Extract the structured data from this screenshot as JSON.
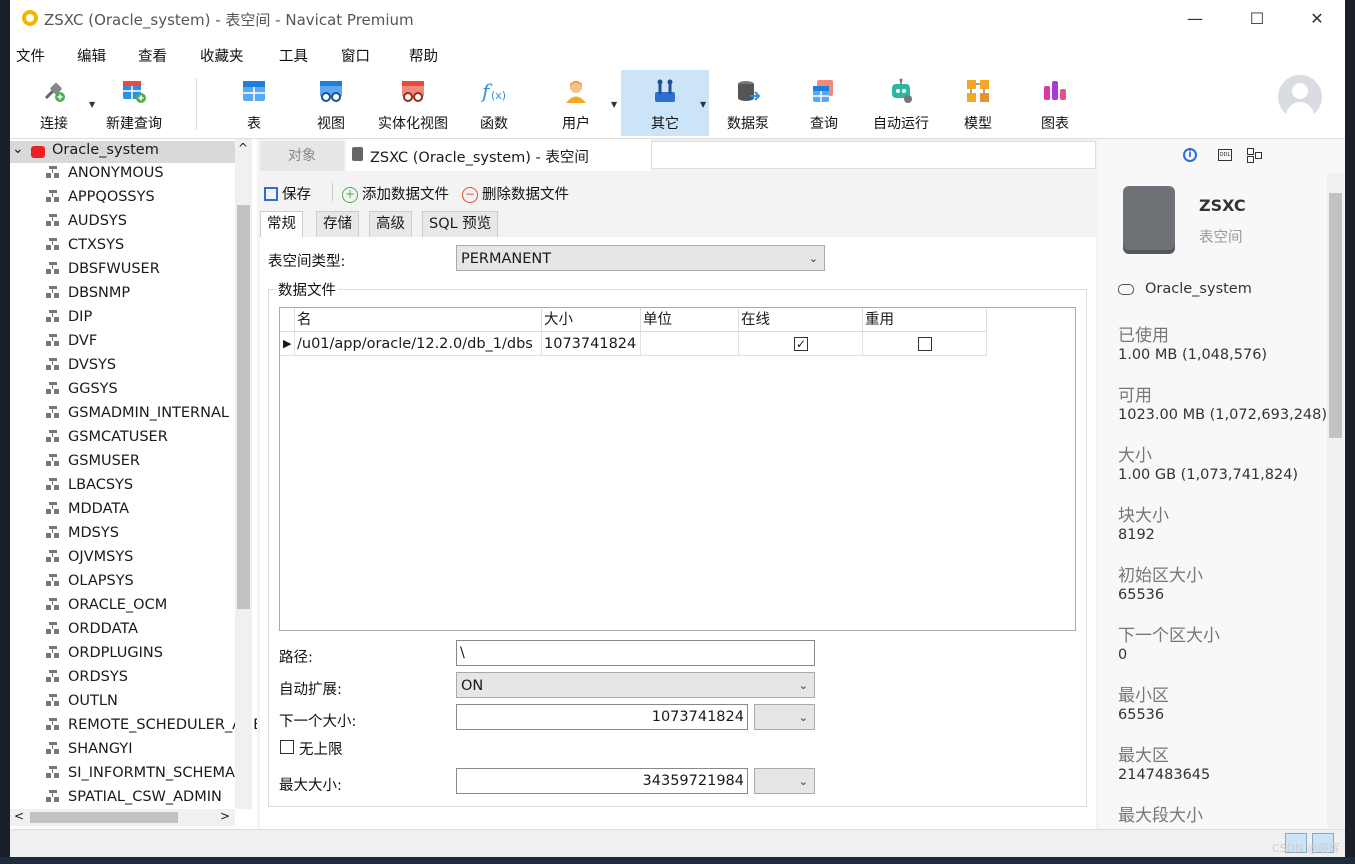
{
  "window": {
    "title": "ZSXC (Oracle_system) - 表空间 - Navicat Premium",
    "minimize": "—",
    "maximize": "☐",
    "close": "✕"
  },
  "menu": [
    "文件",
    "编辑",
    "查看",
    "收藏夹",
    "工具",
    "窗口",
    "帮助"
  ],
  "toolbar": [
    {
      "label": "连接",
      "icon": "connection-plug-icon",
      "color": "#4caf50"
    },
    {
      "label": "新建查询",
      "icon": "new-query-icon",
      "color": "#e84a3c"
    },
    {
      "label": "表",
      "icon": "table-icon",
      "color": "#2f8fe0"
    },
    {
      "label": "视图",
      "icon": "view-glasses-icon",
      "color": "#2f8fe0"
    },
    {
      "label": "实体化视图",
      "icon": "materialized-view-icon",
      "color": "#e84a3c"
    },
    {
      "label": "函数",
      "icon": "function-fx-icon",
      "color": "#2f8fe0"
    },
    {
      "label": "用户",
      "icon": "user-icon",
      "color": "#f5a623"
    },
    {
      "label": "其它",
      "icon": "tools-icon",
      "color": "#2f6fd0"
    },
    {
      "label": "数据泵",
      "icon": "data-pump-icon",
      "color": "#555555"
    },
    {
      "label": "查询",
      "icon": "query-icon",
      "color": "#e84a3c"
    },
    {
      "label": "自动运行",
      "icon": "robot-icon",
      "color": "#2eb6a0"
    },
    {
      "label": "模型",
      "icon": "model-icon",
      "color": "#f5a623"
    },
    {
      "label": "图表",
      "icon": "chart-icon",
      "color": "#d63aa7"
    }
  ],
  "tree": {
    "root": "Oracle_system",
    "expander": "⌄",
    "items": [
      "ANONYMOUS",
      "APPQOSSYS",
      "AUDSYS",
      "CTXSYS",
      "DBSFWUSER",
      "DBSNMP",
      "DIP",
      "DVF",
      "DVSYS",
      "GGSYS",
      "GSMADMIN_INTERNAL",
      "GSMCATUSER",
      "GSMUSER",
      "LBACSYS",
      "MDDATA",
      "MDSYS",
      "OJVMSYS",
      "OLAPSYS",
      "ORACLE_OCM",
      "ORDDATA",
      "ORDPLUGINS",
      "ORDSYS",
      "OUTLN",
      "REMOTE_SCHEDULER_AGENT",
      "SHANGYI",
      "SI_INFORMTN_SCHEMA",
      "SPATIAL_CSW_ADMIN"
    ],
    "scroll_up": "^",
    "scroll_left": "<",
    "scroll_right": ">"
  },
  "tabs": {
    "objects": "对象",
    "active": "ZSXC (Oracle_system) - 表空间"
  },
  "actions": {
    "save": "保存",
    "add_datafile": "添加数据文件",
    "delete_datafile": "删除数据文件"
  },
  "subtabs": [
    "常规",
    "存储",
    "高级",
    "SQL 预览"
  ],
  "form": {
    "tablespace_type_label": "表空间类型:",
    "tablespace_type_value": "PERMANENT",
    "datafiles_group": "数据文件",
    "columns": [
      "名",
      "大小",
      "单位",
      "在线",
      "重用"
    ],
    "rows": [
      {
        "name": "/u01/app/oracle/12.2.0/db_1/dbs",
        "size": "1073741824",
        "unit": "",
        "online": true,
        "reuse": false
      }
    ],
    "row_pointer": "▶",
    "path_label": "路径:",
    "path_value": "\\",
    "autoextend_label": "自动扩展:",
    "autoextend_value": "ON",
    "next_size_label": "下一个大小:",
    "next_size_value": "1073741824",
    "next_size_unit": "",
    "unlimited_label": "无上限",
    "unlimited_checked": false,
    "max_size_label": "最大大小:",
    "max_size_value": "34359721984",
    "max_size_unit": ""
  },
  "info": {
    "name": "ZSXC",
    "type": "表空间",
    "connection": "Oracle_system",
    "fields": [
      {
        "label": "已使用",
        "value": "1.00 MB (1,048,576)"
      },
      {
        "label": "可用",
        "value": "1023.00 MB (1,072,693,248)"
      },
      {
        "label": "大小",
        "value": "1.00 GB (1,073,741,824)"
      },
      {
        "label": "块大小",
        "value": "8192"
      },
      {
        "label": "初始区大小",
        "value": "65536"
      },
      {
        "label": "下一个区大小",
        "value": "0"
      },
      {
        "label": "最小区",
        "value": "65536"
      },
      {
        "label": "最大区",
        "value": "2147483645"
      },
      {
        "label": "最大段大小",
        "value": ""
      }
    ],
    "tab_icons": [
      "info-icon",
      "ddl-icon",
      "dependency-icon"
    ]
  },
  "watermark": "CSDN @晓晖"
}
